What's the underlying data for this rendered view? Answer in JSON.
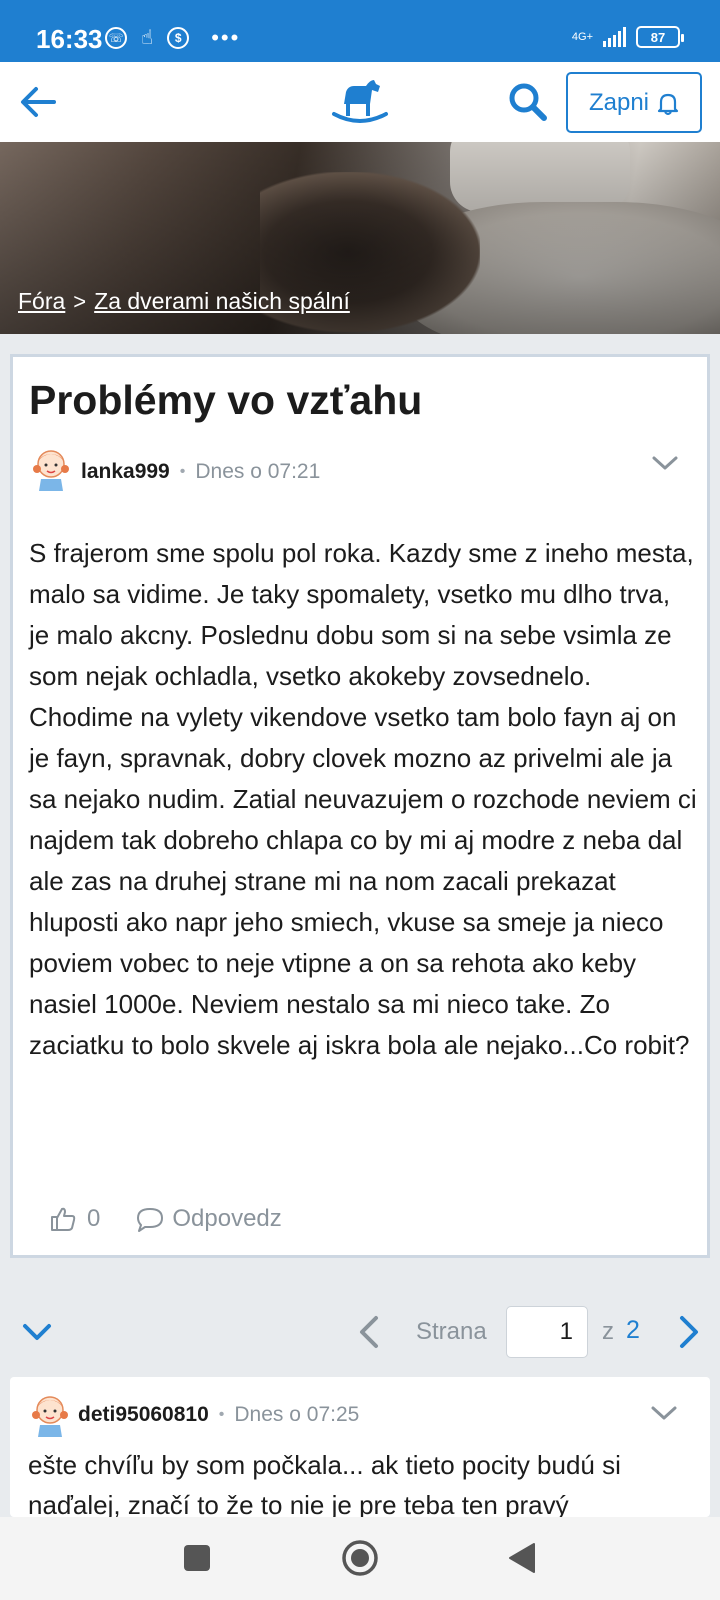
{
  "status_bar": {
    "time": "16:33",
    "network": "4G+",
    "battery": "87"
  },
  "nav": {
    "notify_label": "Zapni"
  },
  "breadcrumb": {
    "forums": "Fóra",
    "separator": ">",
    "category": "Za dverami našich spální"
  },
  "post": {
    "title": "Problémy vo vzťahu",
    "author": "lanka999",
    "date": "Dnes o 07:21",
    "body": "S frajerom sme spolu pol roka. Kazdy sme z ineho mesta, malo sa vidime. Je taky spomalety, vsetko mu dlho trva, je malo akcny. Poslednu dobu som si na sebe vsimla ze som nejak ochladla, vsetko akokeby zovsednelo. Chodime na vylety vikendove vsetko tam bolo fayn aj on je fayn, spravnak, dobry clovek mozno az privelmi ale ja sa nejako nudim. Zatial neuvazujem o rozchode neviem ci najdem tak dobreho chlapa co by mi aj modre z neba dal ale zas na druhej strane mi na nom zacali prekazat hluposti ako napr jeho smiech, vkuse sa smeje ja nieco poviem vobec to neje vtipne a on sa rehota ako keby nasiel 1000e. Neviem nestalo sa mi nieco take. Zo zaciatku to bolo skvele aj iskra bola ale nejako...Co robit?",
    "likes": "0",
    "reply_label": "Odpovedz"
  },
  "pagination": {
    "label": "Strana",
    "current": "1",
    "of": "z",
    "total": "2"
  },
  "reply": {
    "author": "deti95060810",
    "date": "Dnes o 07:25",
    "body": "ešte chvíľu by som počkala... ak tieto pocity budú si naďalej, značí to že to nie je pre teba ten pravý"
  },
  "colors": {
    "accent": "#1f7fd0",
    "status_bar": "#1f7fd0",
    "card_border": "#cdd7e2",
    "muted": "#8a939b"
  }
}
